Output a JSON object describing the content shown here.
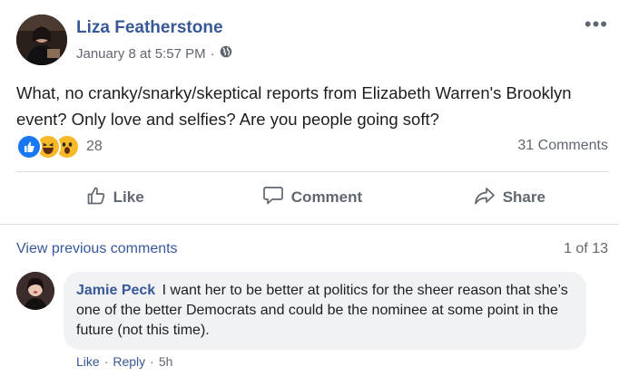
{
  "post": {
    "author": "Liza Featherstone",
    "timestamp": "January 8 at 5:57 PM",
    "separator": "·",
    "audience_icon": "globe-icon",
    "more_icon": "more-options-icon",
    "more_glyph": "•••",
    "text": "What, no cranky/snarky/skeptical reports from Elizabeth Warren's Brooklyn event? Only love and selfies? Are you people going soft?",
    "reaction_count": "28",
    "comment_count": "31 Comments"
  },
  "actions": {
    "like": "Like",
    "comment": "Comment",
    "share": "Share"
  },
  "comments_nav": {
    "view_previous": "View previous comments",
    "page_count": "1 of 13"
  },
  "comment": {
    "author": "Jamie Peck",
    "text": "I want her to be better at politics for the sheer reason that she’s one of the better Democrats and could be the nominee at some point in the future (not this time).",
    "like": "Like",
    "reply": "Reply",
    "time": "5h",
    "sep1": "·",
    "sep2": "·"
  },
  "colors": {
    "link": "#385898",
    "secondary": "#606770",
    "like_blue": "#1877f2",
    "emoji_yellow": "#f7b928",
    "bubble_bg": "#f0f2f5"
  }
}
